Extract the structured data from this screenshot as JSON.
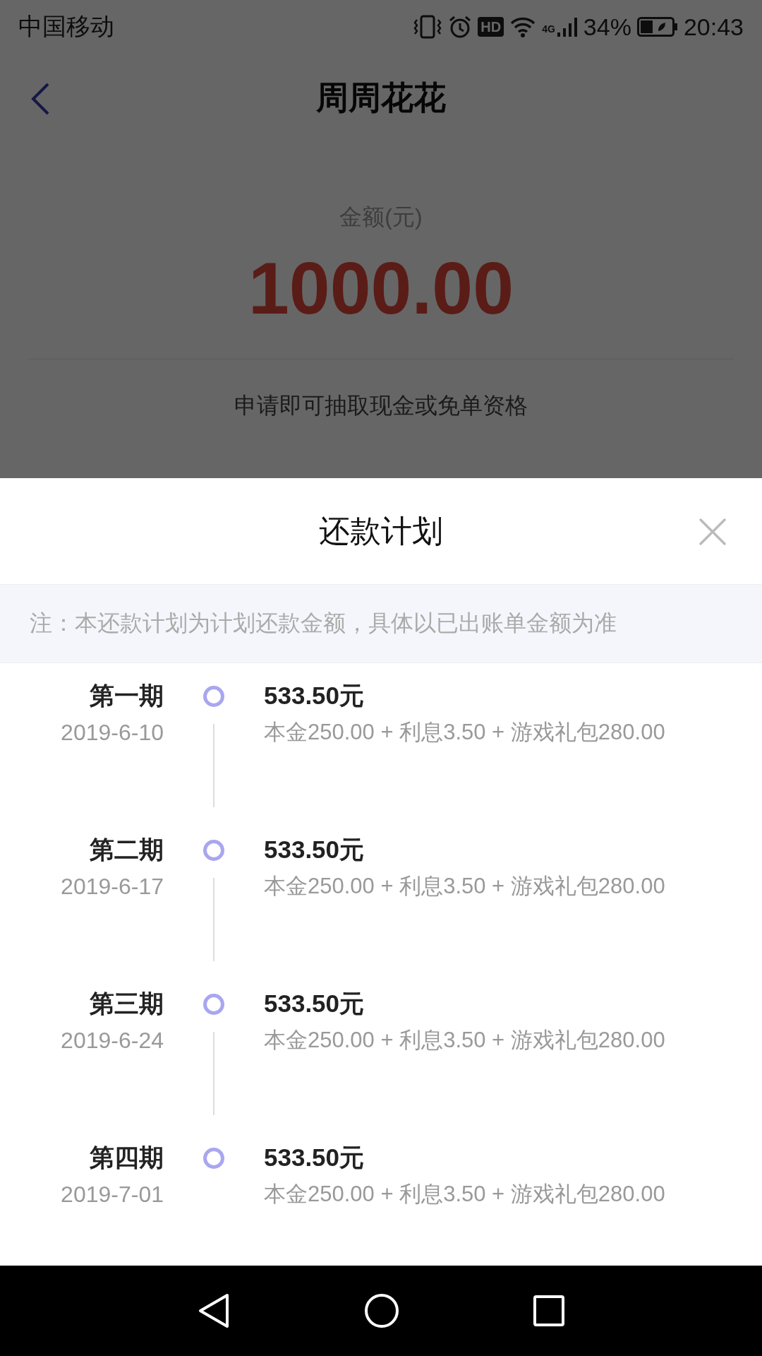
{
  "status_bar": {
    "carrier": "中国移动",
    "hd": "HD",
    "network": "4G",
    "battery": "34%",
    "time": "20:43"
  },
  "page": {
    "dimmed": true,
    "title": "周周花花",
    "amount_label": "金额(元)",
    "amount": "1000.00",
    "promo": "申请即可抽取现金或免单资格"
  },
  "sheet": {
    "title": "还款计划",
    "note": "注：本还款计划为计划还款金额，具体以已出账单金额为准",
    "installments": [
      {
        "period": "第一期",
        "date": "2019-6-10",
        "amount": "533.50元",
        "breakdown": "本金250.00 + 利息3.50 + 游戏礼包280.00"
      },
      {
        "period": "第二期",
        "date": "2019-6-17",
        "amount": "533.50元",
        "breakdown": "本金250.00 + 利息3.50 + 游戏礼包280.00"
      },
      {
        "period": "第三期",
        "date": "2019-6-24",
        "amount": "533.50元",
        "breakdown": "本金250.00 + 利息3.50 + 游戏礼包280.00"
      },
      {
        "period": "第四期",
        "date": "2019-7-01",
        "amount": "533.50元",
        "breakdown": "本金250.00 + 利息3.50 + 游戏礼包280.00"
      }
    ]
  }
}
